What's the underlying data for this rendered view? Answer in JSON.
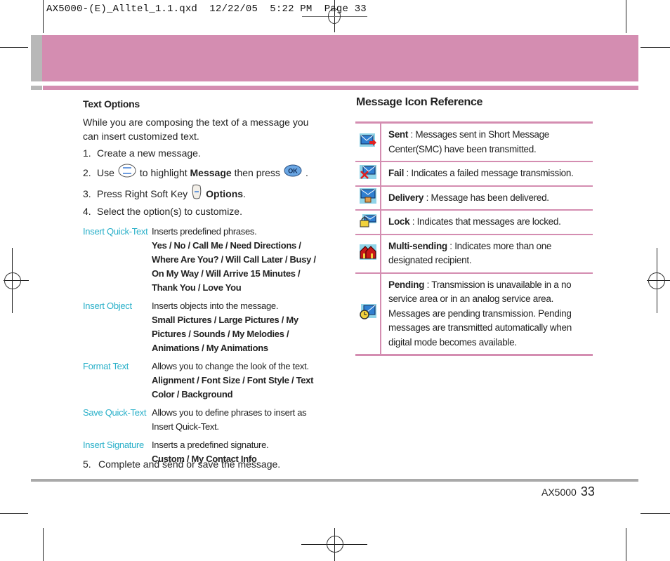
{
  "slug": {
    "filename": "AX5000-(E)_Alltel_1.1.qxd",
    "date": "12/22/05",
    "time": "5:22 PM",
    "page_label": "Page 33"
  },
  "colors": {
    "accent_pink": "#d48db1",
    "accent_gray": "#b8b8b8",
    "option_label_cyan": "#2ab0c9"
  },
  "text_options": {
    "heading": "Text Options",
    "intro": "While you are composing the text of a message you can insert customized text.",
    "steps": [
      {
        "num": "1.",
        "text": "Create a new message."
      },
      {
        "num": "2.",
        "pre": "Use",
        "nav_key_icon": "nav-key-icon",
        "mid": "to highlight",
        "bold": "Message",
        "post": "then press",
        "ok_key_icon": "ok-key-icon",
        "ok_label": "OK",
        "end": "."
      },
      {
        "num": "3.",
        "pre": "Press Right Soft Key",
        "soft_key_icon": "right-soft-key-icon",
        "bold": "Options",
        "end": "."
      },
      {
        "num": "4.",
        "text": "Select the option(s) to customize."
      },
      {
        "num": "5.",
        "text": "Complete and send or save the message."
      }
    ],
    "options": [
      {
        "label": "Insert Quick-Text",
        "desc": "Inserts predefined phrases.",
        "choices": "Yes / No / Call Me / Need Directions / Where Are You? / Will Call Later / Busy / On My Way / Will Arrive 15 Minutes / Thank You / Love You"
      },
      {
        "label": "Insert Object",
        "desc": "Inserts objects into the message.",
        "choices": "Small Pictures / Large Pictures / My Pictures / Sounds / My Melodies / Animations / My Animations"
      },
      {
        "label": "Format Text",
        "desc": "Allows you to change the look of the text.",
        "choices": "Alignment / Font Size / Font Style / Text Color / Background"
      },
      {
        "label": "Save Quick-Text",
        "desc": "Allows you to define phrases to insert as Insert Quick-Text.",
        "choices": ""
      },
      {
        "label": "Insert Signature",
        "desc": "Inserts a predefined signature.",
        "choices": "Custom / My Contact Info"
      }
    ]
  },
  "icon_reference": {
    "heading": "Message Icon Reference",
    "rows": [
      {
        "icon": "sent-icon",
        "term": "Sent",
        "desc": " : Messages sent in Short Message Center(SMC) have been transmitted."
      },
      {
        "icon": "fail-icon",
        "term": "Fail",
        "desc": " : Indicates a failed message transmission."
      },
      {
        "icon": "delivery-icon",
        "term": "Delivery",
        "desc": " : Message has been delivered."
      },
      {
        "icon": "lock-icon",
        "term": "Lock",
        "desc": " : Indicates that messages are locked."
      },
      {
        "icon": "multi-sending-icon",
        "term": "Multi-sending",
        "desc": " : Indicates more than one designated recipient."
      },
      {
        "icon": "pending-icon",
        "term": "Pending",
        "desc": " : Transmission is unavailable in a no service area or in an analog service area. Messages are pending transmission. Pending messages are transmitted automatically when digital mode becomes available."
      }
    ]
  },
  "footer": {
    "model": "AX5000",
    "page_number": "33"
  }
}
